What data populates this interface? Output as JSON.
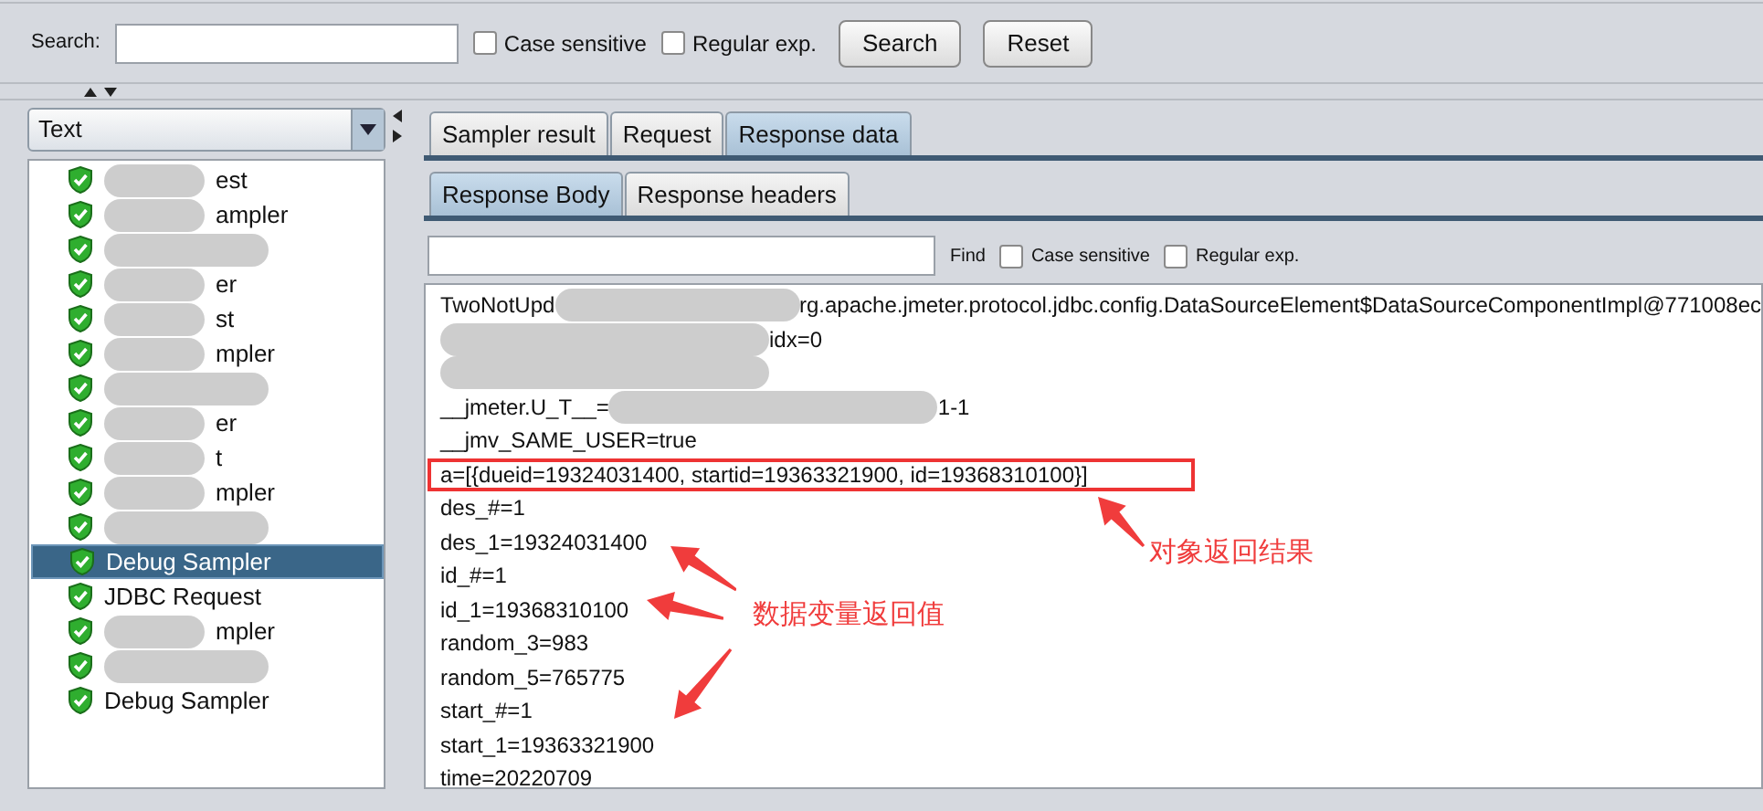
{
  "search": {
    "label": "Search:",
    "case_sensitive": {
      "label": "Case sensitive",
      "checked": false
    },
    "regex": {
      "label": "Regular exp.",
      "checked": false
    },
    "buttons": [
      "Search",
      "Reset"
    ]
  },
  "renderer": {
    "value": "Text"
  },
  "tree": [
    {
      "text": "est",
      "redacted": true,
      "selected": false
    },
    {
      "text": "ampler",
      "redacted": true,
      "selected": false
    },
    {
      "redacted": true,
      "selected": false
    },
    {
      "text": "er",
      "redacted": true,
      "selected": false
    },
    {
      "text": "st",
      "redacted": true,
      "selected": false
    },
    {
      "text": "mpler",
      "redacted": true,
      "selected": false
    },
    {
      "redacted": true,
      "selected": false
    },
    {
      "text": "er",
      "redacted": true,
      "selected": false
    },
    {
      "text": "t",
      "redacted": true,
      "selected": false
    },
    {
      "text": "mpler",
      "redacted": true,
      "selected": false
    },
    {
      "redacted": true,
      "selected": false
    },
    {
      "text": "Debug Sampler",
      "redacted": false,
      "selected": true
    },
    {
      "text": "JDBC Request",
      "redacted": false,
      "selected": false
    },
    {
      "text": "mpler",
      "redacted": true,
      "selected": false
    },
    {
      "redacted": true,
      "selected": false
    },
    {
      "text": "Debug Sampler",
      "redacted": false,
      "selected": false
    }
  ],
  "tabs": [
    {
      "label": "Sampler result",
      "selected": false
    },
    {
      "label": "Request",
      "selected": false
    },
    {
      "label": "Response data",
      "selected": true
    }
  ],
  "subtabs": [
    {
      "label": "Response Body",
      "selected": true
    },
    {
      "label": "Response headers",
      "selected": false
    }
  ],
  "find": {
    "label": "Find",
    "case_sensitive": {
      "label": "Case sensitive",
      "checked": false
    },
    "regex": {
      "label": "Regular exp.",
      "checked": false
    }
  },
  "lines": [
    {
      "parts": [
        {
          "kind": "text",
          "text": "TwoNotUpd"
        },
        {
          "kind": "blur"
        },
        {
          "kind": "text",
          "text": "rg.apache.jmeter.protocol.jdbc.config.DataSourceElement$DataSourceComponentImpl@771008ec"
        }
      ]
    },
    {
      "parts": [
        {
          "kind": "blur"
        },
        {
          "kind": "text",
          "text": "idx=0"
        }
      ]
    },
    {
      "parts": [
        {
          "kind": "blur"
        }
      ]
    },
    {
      "parts": [
        {
          "kind": "text",
          "text": "__jmeter.U_T__="
        },
        {
          "kind": "blur"
        },
        {
          "kind": "text",
          "text": "1-1"
        }
      ]
    },
    {
      "parts": [
        {
          "kind": "text",
          "text": "__jmv_SAME_USER=true"
        }
      ]
    },
    {
      "boxed": true,
      "parts": [
        {
          "kind": "text",
          "text": "a=[{dueid=19324031400, startid=19363321900, id=19368310100}]"
        }
      ]
    },
    {
      "parts": [
        {
          "kind": "text",
          "text": "des_#=1"
        }
      ]
    },
    {
      "parts": [
        {
          "kind": "text",
          "text": "des_1=19324031400"
        }
      ]
    },
    {
      "parts": [
        {
          "kind": "text",
          "text": "id_#=1"
        }
      ]
    },
    {
      "parts": [
        {
          "kind": "text",
          "text": "id_1=19368310100"
        }
      ]
    },
    {
      "parts": [
        {
          "kind": "text",
          "text": "random_3=983"
        }
      ]
    },
    {
      "parts": [
        {
          "kind": "text",
          "text": "random_5=765775"
        }
      ]
    },
    {
      "parts": [
        {
          "kind": "text",
          "text": "start_#=1"
        }
      ]
    },
    {
      "parts": [
        {
          "kind": "text",
          "text": "start_1=19363321900"
        }
      ]
    },
    {
      "parts": [
        {
          "kind": "text",
          "text": "time=20220709"
        }
      ]
    }
  ],
  "annotations": [
    "对象返回结果",
    "数据变量返回值"
  ]
}
